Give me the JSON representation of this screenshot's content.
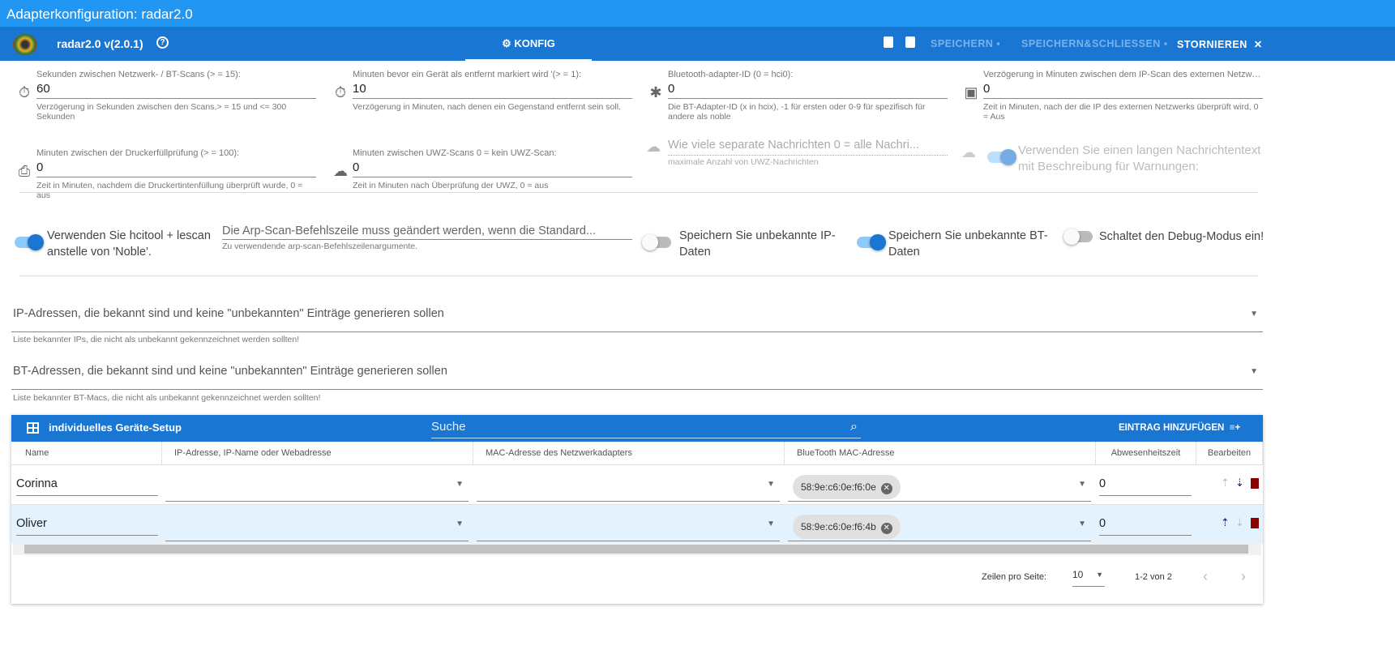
{
  "window_title": "Adapterkonfiguration: radar2.0",
  "toolbar": {
    "adapter_name": "radar2.0 v(2.0.1)",
    "tab_konfig": "KONFIG",
    "save": "SPEICHERN",
    "save_close": "SPEICHERN&SCHLIESSEN",
    "cancel": "STORNIEREN"
  },
  "fields": [
    {
      "label": "Sekunden zwischen Netzwerk- / BT-Scans (> = 15):",
      "value": "60",
      "help": "Verzögerung in Sekunden zwischen den Scans,> = 15 und <= 300 Sekunden",
      "icon": "timer-icon"
    },
    {
      "label": "Minuten bevor ein Gerät als entfernt markiert wird '(> = 1):",
      "value": "10",
      "help": "Verzögerung in Minuten, nach denen ein Gegenstand entfernt sein soll.",
      "icon": "timer-off-icon"
    },
    {
      "label": "Bluetooth-adapter-ID (0 = hci0):",
      "value": "0",
      "help": "Die BT-Adapter-ID (x in hcix), -1 für ersten oder 0-9 für spezifisch für andere als noble",
      "icon": "bluetooth-icon"
    },
    {
      "label": "Verzögerung in Minuten zwischen dem IP-Scan des externen Netzwer...",
      "value": "0",
      "help": "Zeit in Minuten, nach der die IP des externen Netzwerks überprüft wird, 0 = Aus",
      "icon": "network-check-icon"
    },
    {
      "label": "Minuten zwischen der Druckerfüllprüfung (> = 100):",
      "value": "0",
      "help": "Zeit in Minuten, nachdem die Druckertintenfüllung überprüft wurde, 0 = aus",
      "icon": "printer-icon"
    },
    {
      "label": "Minuten zwischen UWZ-Scans 0 = kein UWZ-Scan:",
      "value": "0",
      "help": "Zeit in Minuten nach Überprüfung der UWZ, 0 = aus",
      "icon": "cloud-alert-icon"
    }
  ],
  "uwz_messages": {
    "placeholder": "Wie viele separate Nachrichten 0 = alle Nachri...",
    "help": "maximale Anzahl von UWZ-Nachrichten"
  },
  "long_text_toggle": {
    "label": "Verwenden Sie einen langen Nachrichtentext mit Beschreibung für Warnungen:",
    "on": true
  },
  "toggles": [
    {
      "label": "Verwenden Sie hcitool + lescan anstelle von 'Noble'.",
      "on": true
    },
    {
      "label": "Speichern Sie unbekannte IP-Daten",
      "on": false
    },
    {
      "label": "Speichern Sie unbekannte BT-Daten",
      "on": true
    },
    {
      "label": "Schaltet den Debug-Modus ein!",
      "on": false
    }
  ],
  "arp": {
    "placeholder": "Die Arp-Scan-Befehlszeile muss geändert werden, wenn die Standard...",
    "help": "Zu verwendende arp-scan-Befehlszeilenargumente."
  },
  "accordions": [
    {
      "title": "IP-Adressen, die bekannt sind und keine \"unbekannten\" Einträge generieren sollen",
      "help": "Liste bekannter IPs, die nicht als unbekannt gekennzeichnet werden sollten!"
    },
    {
      "title": "BT-Adressen, die bekannt sind und keine \"unbekannten\" Einträge generieren sollen",
      "help": "Liste bekannter BT-Macs, die nicht als unbekannt gekennzeichnet werden sollten!"
    }
  ],
  "table": {
    "title": "individuelles Geräte-Setup",
    "search_placeholder": "Suche",
    "add": "EINTRAG HINZUFÜGEN",
    "columns": [
      "Name",
      "IP-Adresse, IP-Name oder Webadresse",
      "MAC-Adresse des Netzwerkadapters",
      "BlueTooth MAC-Adresse",
      "Abwesenheitszeit",
      "Bearbeiten"
    ],
    "rows": [
      {
        "name": "Corinna",
        "ip": "",
        "mac": "",
        "bt": "58:9e:c6:0e:f6:0e",
        "absence": "0"
      },
      {
        "name": "Oliver",
        "ip": "",
        "mac": "",
        "bt": "58:9e:c6:0e:f6:4b",
        "absence": "0"
      }
    ],
    "rows_per_page_label": "Zeilen pro Seite:",
    "rows_per_page": "10",
    "range": "1-2 von 2"
  },
  "colors": {
    "title": "#2196f3",
    "toolbar": "#1976d2",
    "selected_row": "#e3f2fd"
  }
}
